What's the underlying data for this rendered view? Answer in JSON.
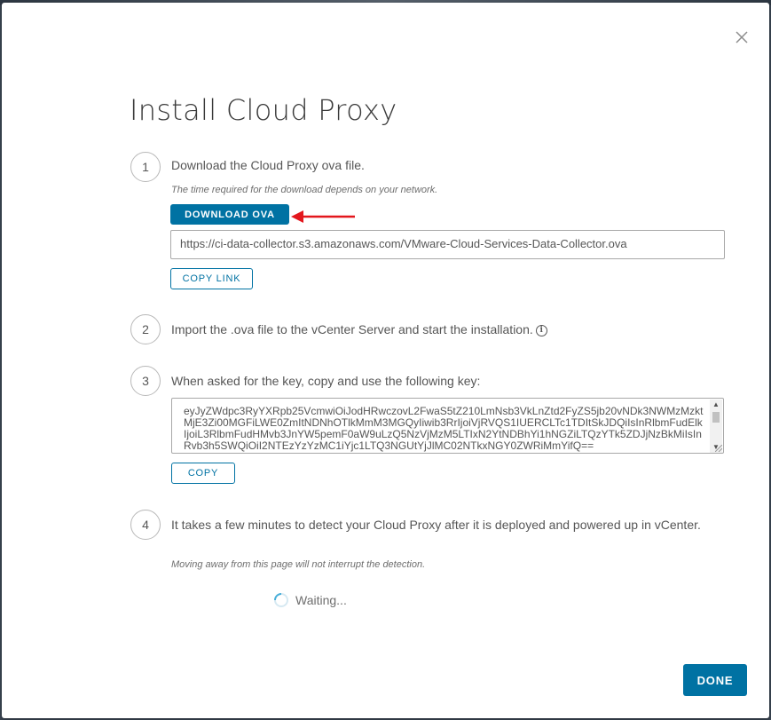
{
  "colors": {
    "accent": "#0072a3",
    "annotation_arrow": "#e3161c",
    "spinner": "#49afd9"
  },
  "dialog": {
    "title": "Install Cloud Proxy",
    "close_icon": "close-icon"
  },
  "steps": [
    {
      "number": "1",
      "text": "Download the Cloud Proxy ova file.",
      "hint": "The time required for the download depends on your network.",
      "download_button": "DOWNLOAD OVA",
      "url_value": "https://ci-data-collector.s3.amazonaws.com/VMware-Cloud-Services-Data-Collector.ova",
      "copy_link_button": "COPY LINK"
    },
    {
      "number": "2",
      "text": "Import the .ova file to the vCenter Server and start the installation.",
      "info_icon": "info-icon"
    },
    {
      "number": "3",
      "text": "When asked for the key, copy and use the following key:",
      "key_value": "eyJyZWdpc3RyYXRpb25VcmwiOiJodHRwczovL2FwaS5tZ210LmNsb3VkLnZtd2FyZS5jb20vNDk3NWMzMzktMjE3Zi00MGFiLWE0ZmItNDNhOTlkMmM3MGQyIiwib3RrIjoiVjRVQS1IUERCLTc1TDItSkJDQiIsInRlbmFudElkIjoiL3RlbmFudHMvb3JnYW5pemF0aW9uLzQ5NzVjMzM5LTIxN2YtNDBhYi1hNGZiLTQzYTk5ZDJjNzBkMiIsInRvb3h5SWQiOiI2NTEzYzYzMC1iYjc1LTQ3NGUtYjJlMC02NTkxNGY0ZWRiMmYifQ==",
      "copy_button": "COPY"
    },
    {
      "number": "4",
      "text": "It takes a few minutes to detect your Cloud Proxy after it is deployed and powered up in vCenter.",
      "hint": "Moving away from this page will not interrupt the detection.",
      "status": "Waiting..."
    }
  ],
  "footer": {
    "done_button": "DONE"
  }
}
